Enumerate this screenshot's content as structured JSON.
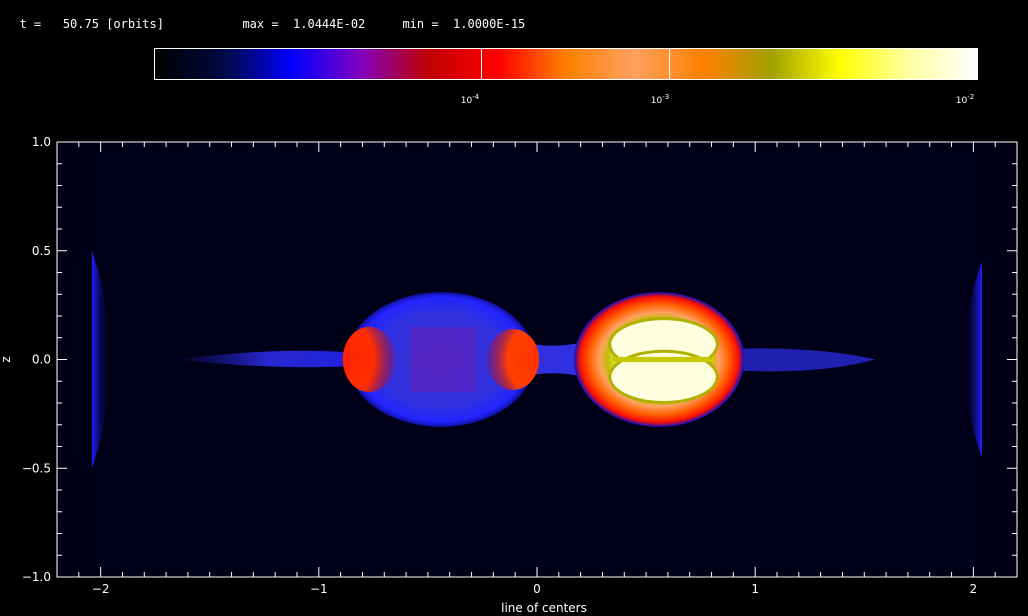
{
  "header": {
    "time_label": "t =",
    "time_value": "50.75",
    "time_unit": "[orbits]",
    "max_label": "max =",
    "max_value": "1.0444E-02",
    "min_label": "min =",
    "min_value": "1.0000E-15"
  },
  "colorbar": {
    "scale": "log",
    "labels": [
      {
        "base": "10",
        "exp": "-4",
        "value": 0.0001
      },
      {
        "base": "10",
        "exp": "-3",
        "value": 0.001
      },
      {
        "base": "10",
        "exp": "-2",
        "value": 0.01
      }
    ],
    "colors": [
      "#000000",
      "#000a40",
      "#0000ff",
      "#8000c0",
      "#c00000",
      "#ff0000",
      "#ff8000",
      "#ffa060",
      "#ff8000",
      "#a0a000",
      "#ffff00",
      "#ffffa0",
      "#ffffff"
    ]
  },
  "chart_data": {
    "type": "heatmap",
    "xlabel": "line of centers",
    "ylabel": "z",
    "xlim": [
      -2.2,
      2.2
    ],
    "ylim": [
      -1.0,
      1.0
    ],
    "xticks": [
      -2,
      -1,
      0,
      1,
      2
    ],
    "xtick_labels": [
      "−2",
      "−1",
      "0",
      "1",
      "2"
    ],
    "yticks": [
      -1.0,
      -0.5,
      0.0,
      0.5,
      1.0
    ],
    "ytick_labels": [
      "−1.0",
      "−0.5",
      "0.0",
      "0.5",
      "1.0"
    ],
    "background_color": "#000016",
    "features": [
      {
        "name": "left-lobe",
        "cx": -0.44,
        "cz": 0.0,
        "rx": 0.43,
        "rz": 0.31,
        "color": "#2020ff"
      },
      {
        "name": "right-lobe",
        "cx": 0.56,
        "cz": 0.0,
        "rx": 0.39,
        "rz": 0.31,
        "color": "#ff2000"
      },
      {
        "name": "right-core",
        "cx": 0.58,
        "cz": 0.0,
        "rx": 0.29,
        "rz": 0.19,
        "color": "#ffff60"
      }
    ]
  }
}
